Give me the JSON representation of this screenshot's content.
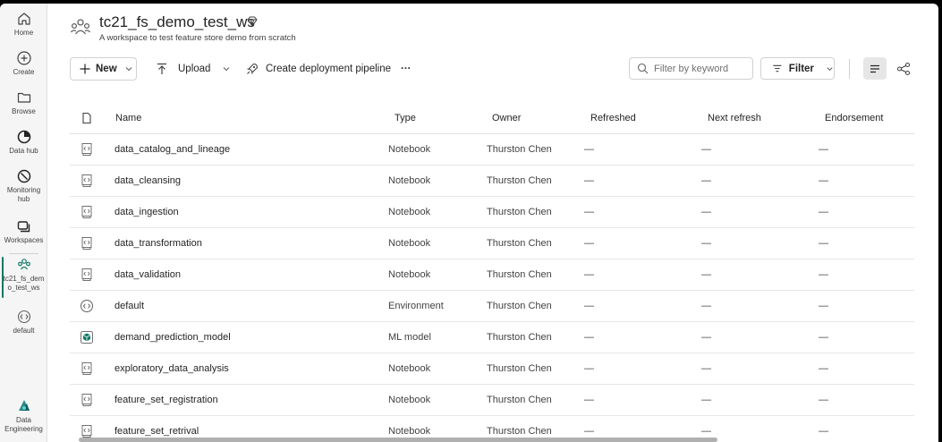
{
  "rail": {
    "home": "Home",
    "create": "Create",
    "browse": "Browse",
    "data_hub": "Data hub",
    "monitoring_line1": "Monitoring",
    "monitoring_line2": "hub",
    "workspaces": "Workspaces",
    "current_ws_line1": "tc21_fs_dem",
    "current_ws_line2": "o_test_ws",
    "default": "default",
    "experience_line1": "Data",
    "experience_line2": "Engineering"
  },
  "header": {
    "title": "tc21_fs_demo_test_ws",
    "subtitle": "A workspace to test feature store demo from scratch"
  },
  "toolbar": {
    "new_label": "New",
    "upload_label": "Upload",
    "pipeline_label": "Create deployment pipeline",
    "more_label": "···",
    "search_placeholder": "Filter by keyword",
    "filter_label": "Filter"
  },
  "table": {
    "columns": [
      "Name",
      "Type",
      "Owner",
      "Refreshed",
      "Next refresh",
      "Endorsement"
    ],
    "rows": [
      {
        "name": "data_catalog_and_lineage",
        "type": "Notebook",
        "owner": "Thurston Chen",
        "refreshed": "—",
        "next": "—",
        "endorsement": "—",
        "icon": "notebook-icon"
      },
      {
        "name": "data_cleansing",
        "type": "Notebook",
        "owner": "Thurston Chen",
        "refreshed": "—",
        "next": "—",
        "endorsement": "—",
        "icon": "notebook-icon"
      },
      {
        "name": "data_ingestion",
        "type": "Notebook",
        "owner": "Thurston Chen",
        "refreshed": "—",
        "next": "—",
        "endorsement": "—",
        "icon": "notebook-icon"
      },
      {
        "name": "data_transformation",
        "type": "Notebook",
        "owner": "Thurston Chen",
        "refreshed": "—",
        "next": "—",
        "endorsement": "—",
        "icon": "notebook-icon"
      },
      {
        "name": "data_validation",
        "type": "Notebook",
        "owner": "Thurston Chen",
        "refreshed": "—",
        "next": "—",
        "endorsement": "—",
        "icon": "notebook-icon"
      },
      {
        "name": "default",
        "type": "Environment",
        "owner": "Thurston Chen",
        "refreshed": "—",
        "next": "—",
        "endorsement": "—",
        "icon": "environment-icon"
      },
      {
        "name": "demand_prediction_model",
        "type": "ML model",
        "owner": "Thurston Chen",
        "refreshed": "—",
        "next": "—",
        "endorsement": "—",
        "icon": "ml-model-icon"
      },
      {
        "name": "exploratory_data_analysis",
        "type": "Notebook",
        "owner": "Thurston Chen",
        "refreshed": "—",
        "next": "—",
        "endorsement": "—",
        "icon": "notebook-icon"
      },
      {
        "name": "feature_set_registration",
        "type": "Notebook",
        "owner": "Thurston Chen",
        "refreshed": "—",
        "next": "—",
        "endorsement": "—",
        "icon": "notebook-icon"
      },
      {
        "name": "feature_set_retrival",
        "type": "Notebook",
        "owner": "Thurston Chen",
        "refreshed": "—",
        "next": "—",
        "endorsement": "—",
        "icon": "notebook-icon"
      }
    ]
  },
  "colors": {
    "accent": "#117865",
    "rail_bg": "#f5f5f5"
  }
}
